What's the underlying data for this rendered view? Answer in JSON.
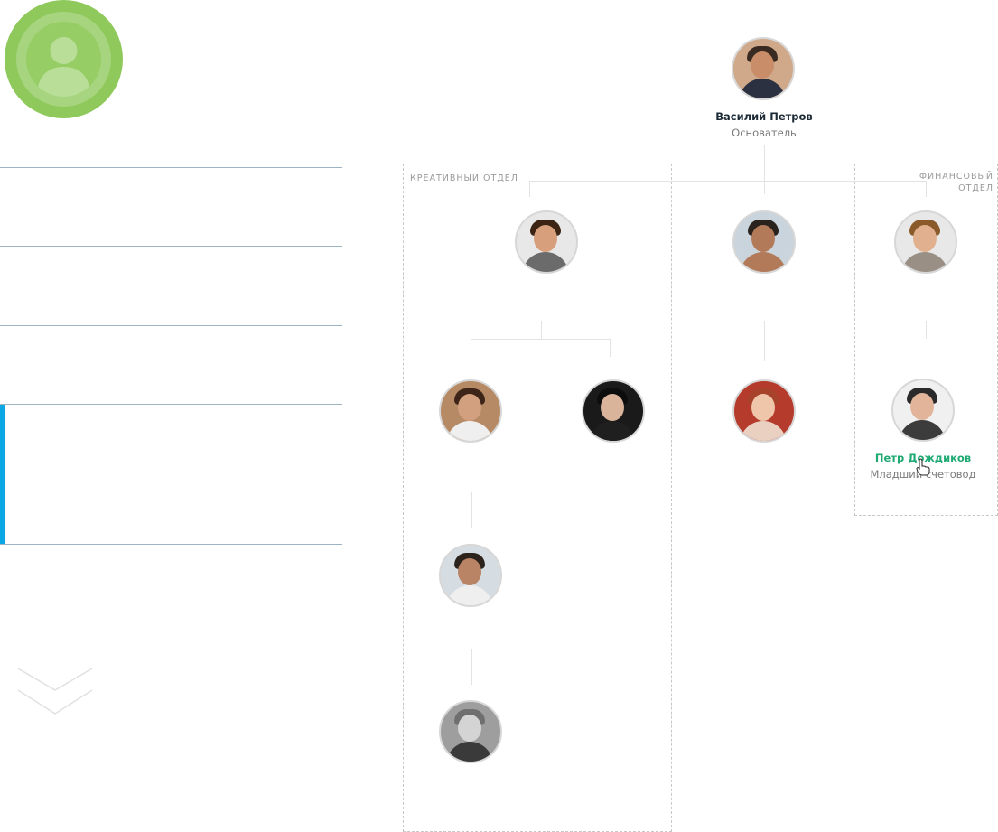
{
  "sidebar": {
    "logo_icon": "user-avatar-icon",
    "menu_items": [
      {
        "label": "",
        "active": false
      },
      {
        "label": "",
        "active": false
      },
      {
        "label": "",
        "active": false
      },
      {
        "label": "",
        "active": true
      }
    ],
    "scroll_icon": "double-chevron-down-icon"
  },
  "org_chart": {
    "root": {
      "name": "Василий Петров",
      "role": "Основатель"
    },
    "departments": [
      {
        "label": "КРЕАТИВНЫЙ ОТДЕЛ"
      },
      {
        "label_line1": "ФИНАНСОВЫЙ",
        "label_line2": "ОТДЕЛ"
      }
    ],
    "highlighted_person": {
      "name": "Петр Дождиков",
      "role": "Младший счетовод"
    }
  },
  "colors": {
    "accent_blue": "#0aa7e4",
    "logo_green": "#8fc95b",
    "highlight_green": "#1eaa72"
  }
}
